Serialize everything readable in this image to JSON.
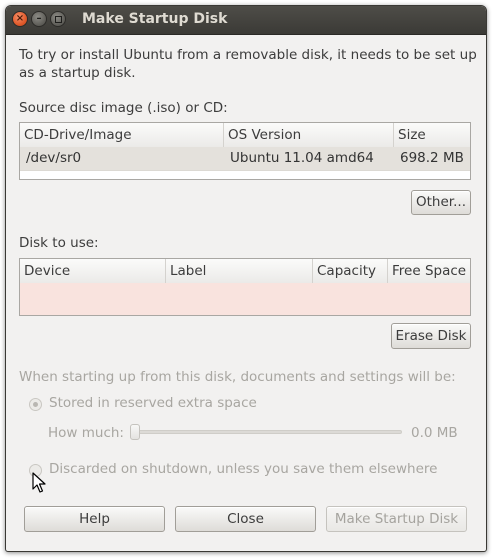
{
  "window": {
    "title": "Make Startup Disk"
  },
  "intro": {
    "line1": "To try or install Ubuntu from a removable disk, it needs to be set up",
    "line2": "as a startup disk."
  },
  "source": {
    "label": "Source disc image (.iso) or CD:",
    "columns": [
      "CD-Drive/Image",
      "OS Version",
      "Size"
    ],
    "rows": [
      {
        "image": "/dev/sr0",
        "os": "Ubuntu 11.04 amd64",
        "size": "698.2 MB"
      }
    ],
    "other_button": "Other..."
  },
  "disk": {
    "label": "Disk to use:",
    "columns": [
      "Device",
      "Label",
      "Capacity",
      "Free Space"
    ],
    "erase_button": "Erase Disk"
  },
  "options": {
    "heading": "When starting up from this disk, documents and settings will be:",
    "stored_label": "Stored in reserved extra space",
    "how_much_label": "How much:",
    "how_much_value": "0.0 MB",
    "discarded_label": "Discarded on shutdown, unless you save them elsewhere"
  },
  "buttons": {
    "help": "Help",
    "close": "Close",
    "make": "Make Startup Disk"
  },
  "colors": {
    "titlebar": "#3c3b37",
    "window_bg": "#f2f1f0",
    "empty_list_bg": "#f9e3de",
    "close_button": "#e05a2b"
  }
}
